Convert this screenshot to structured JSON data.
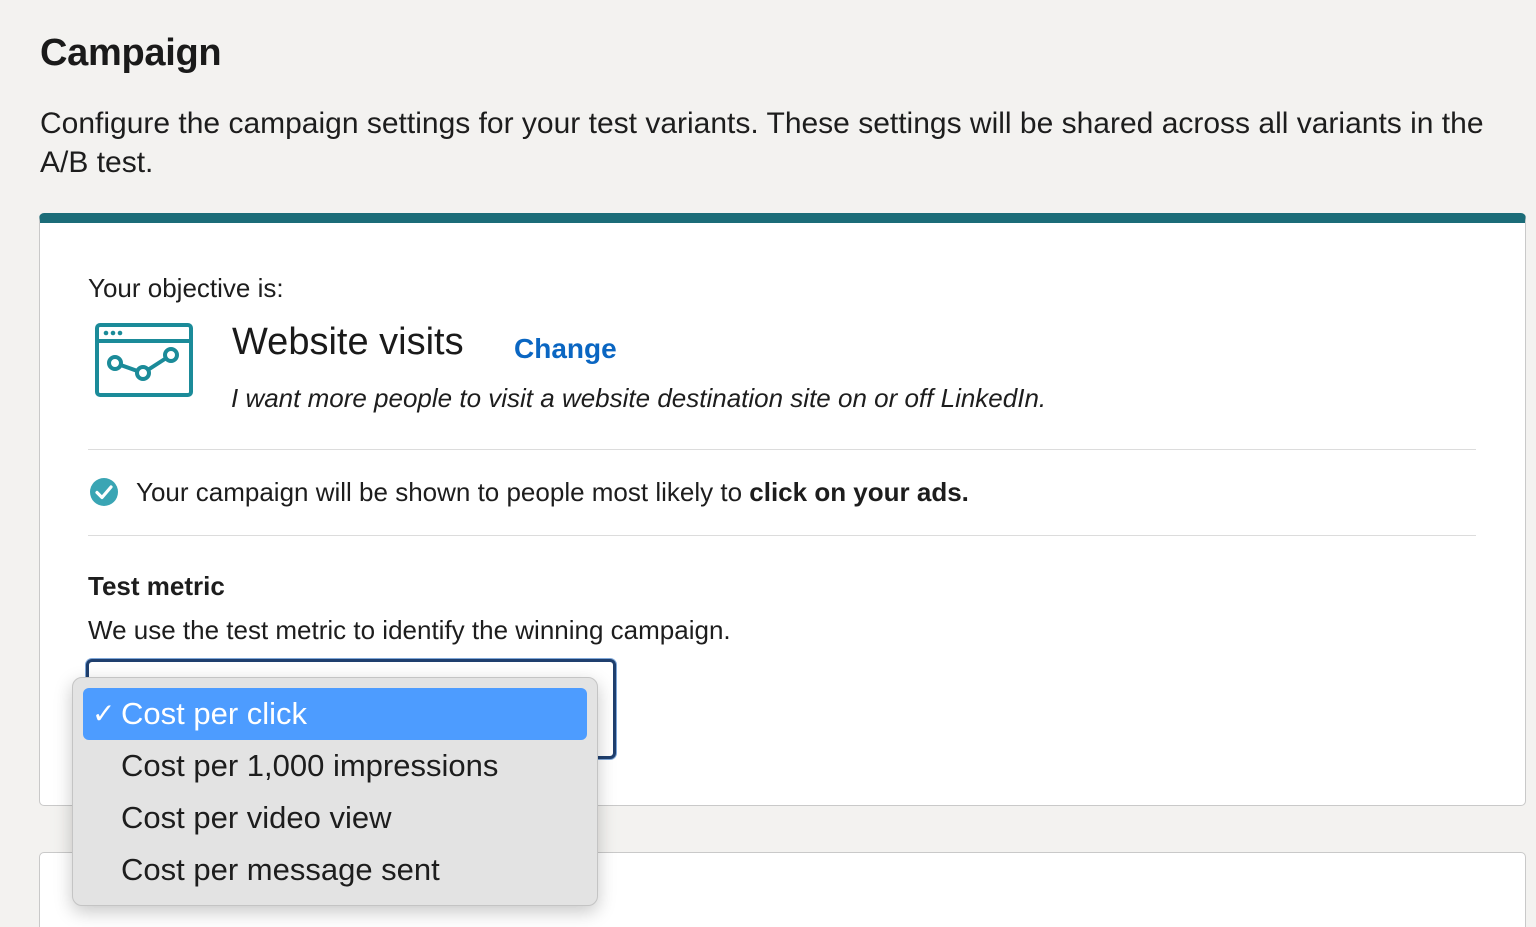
{
  "header": {
    "title": "Campaign",
    "description": "Configure the campaign settings for your test variants. These settings will be shared across all variants in the A/B test."
  },
  "objective": {
    "label": "Your objective is:",
    "name": "Website visits",
    "change_label": "Change",
    "description": "I want more people to visit a website destination site on or off LinkedIn.",
    "icon": "website-visits-icon"
  },
  "info": {
    "text": "Your campaign will be shown to people most likely to ",
    "bold_text": "click on your ads.",
    "icon": "check-circle-icon"
  },
  "test_metric": {
    "heading": "Test metric",
    "description": "We use the test metric to identify the winning campaign.",
    "selected_mark": "✓",
    "options": [
      {
        "label": "Cost per click",
        "selected": true
      },
      {
        "label": "Cost per 1,000 impressions",
        "selected": false
      },
      {
        "label": "Cost per video view",
        "selected": false
      },
      {
        "label": "Cost per message sent",
        "selected": false
      }
    ]
  },
  "colors": {
    "accent_bar": "#1b6c78",
    "link": "#0a66c2",
    "icon_teal": "#1b8b99",
    "check_teal": "#3aa5b4",
    "selected_option": "#4d9cff"
  }
}
